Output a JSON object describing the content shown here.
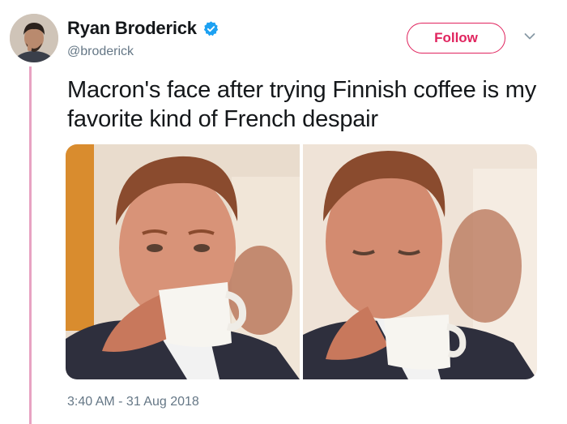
{
  "tweet": {
    "author": {
      "display_name": "Ryan Broderick",
      "handle": "@broderick",
      "verified": true,
      "verified_icon": "verified-badge-icon",
      "avatar_icon": "avatar"
    },
    "follow_label": "Follow",
    "menu_icon": "chevron-down-icon",
    "text": "Macron's face after trying Finnish coffee is my favorite kind of French despair",
    "media": {
      "count": 2,
      "photos": [
        {
          "icon": "photo-man-sipping-coffee"
        },
        {
          "icon": "photo-man-after-sip"
        }
      ]
    },
    "timestamp": "3:40 AM - 31 Aug 2018"
  },
  "colors": {
    "accent": "#e0245e",
    "verified_blue": "#1da1f2",
    "secondary_text": "#657786",
    "thread_line": "#e8a3c2"
  }
}
